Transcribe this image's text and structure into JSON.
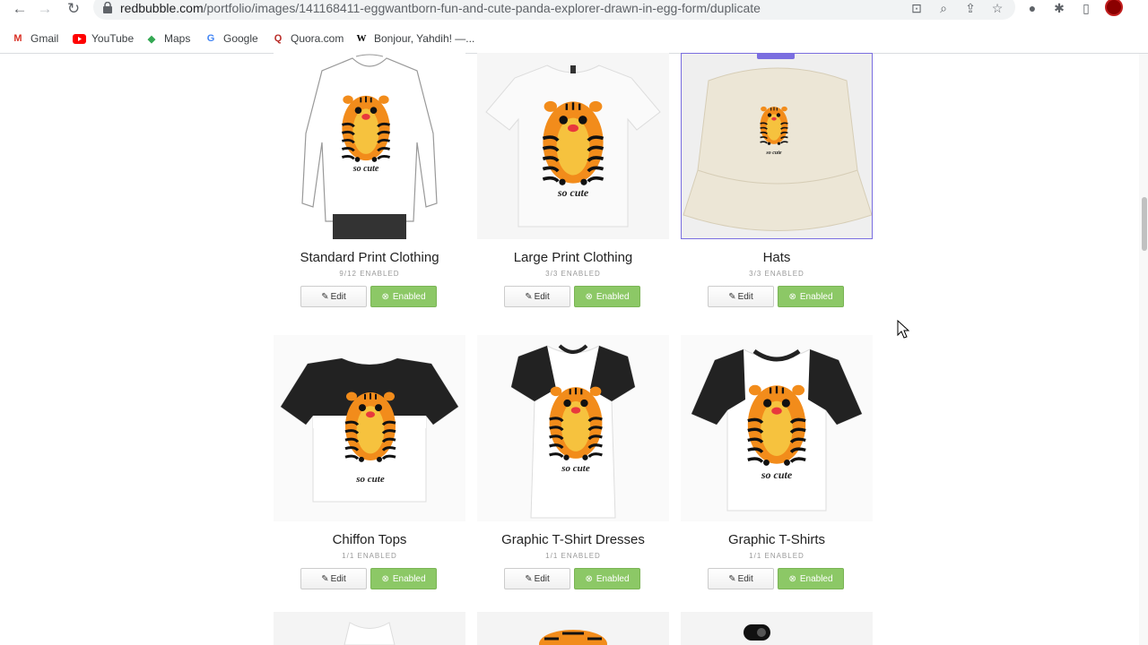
{
  "browser": {
    "url_host": "redbubble.com",
    "url_path": "/portfolio/images/141168411-eggwantborn-fun-and-cute-panda-explorer-drawn-in-egg-form/duplicate",
    "bookmarks": [
      {
        "label": "Gmail",
        "icon": "gmail-icon",
        "color": "#d93025"
      },
      {
        "label": "YouTube",
        "icon": "youtube-icon",
        "color": "#ff0000"
      },
      {
        "label": "Maps",
        "icon": "maps-icon",
        "color": "#34a853"
      },
      {
        "label": "Google",
        "icon": "google-icon",
        "color": "#4285f4"
      },
      {
        "label": "Quora.com",
        "icon": "quora-icon",
        "color": "#b92b27"
      },
      {
        "label": "Bonjour, Yahdih! —...",
        "icon": "wikipedia-icon",
        "color": "#000000"
      }
    ]
  },
  "products": [
    {
      "name": "Standard Print Clothing",
      "count": "9/12 ENABLED",
      "edit": "Edit",
      "enabled": "Enabled",
      "type": "longsleeve"
    },
    {
      "name": "Large Print Clothing",
      "count": "3/3 ENABLED",
      "edit": "Edit",
      "enabled": "Enabled",
      "type": "tshirt"
    },
    {
      "name": "Hats",
      "count": "3/3 ENABLED",
      "edit": "Edit",
      "enabled": "Enabled",
      "type": "hat"
    },
    {
      "name": "Chiffon Tops",
      "count": "1/1 ENABLED",
      "edit": "Edit",
      "enabled": "Enabled",
      "type": "chiffon"
    },
    {
      "name": "Graphic T-Shirt Dresses",
      "count": "1/1 ENABLED",
      "edit": "Edit",
      "enabled": "Enabled",
      "type": "dress"
    },
    {
      "name": "Graphic T-Shirts",
      "count": "1/1 ENABLED",
      "edit": "Edit",
      "enabled": "Enabled",
      "type": "graphic"
    }
  ],
  "colors": {
    "accent": "#7a6ee0",
    "enabled_green": "#8cc866",
    "tiger_orange": "#f28c1b"
  }
}
